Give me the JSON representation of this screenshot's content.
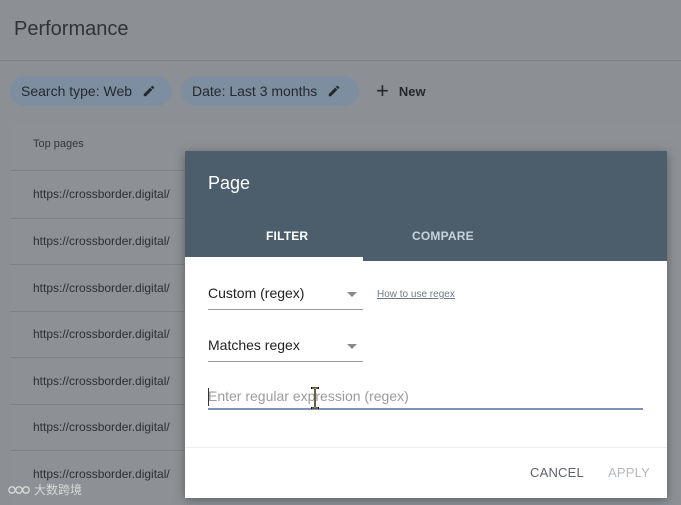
{
  "page": {
    "title": "Performance"
  },
  "chips": [
    {
      "label": "Search type: Web",
      "icon": "pencil-icon"
    },
    {
      "label": "Date: Last 3 months",
      "icon": "pencil-icon"
    }
  ],
  "new_button": {
    "icon": "+",
    "label": "New"
  },
  "table": {
    "header": "Top pages",
    "rows": [
      "https://crossborder.digital/",
      "https://crossborder.digital/",
      "https://crossborder.digital/",
      "https://crossborder.digital/",
      "https://crossborder.digital/",
      "https://crossborder.digital/",
      "https://crossborder.digital/"
    ]
  },
  "modal": {
    "title": "Page",
    "tabs": [
      "FILTER",
      "COMPARE"
    ],
    "active_tab": "FILTER",
    "filter_type": "Custom (regex)",
    "help_link": "How to use regex",
    "match_type": "Matches regex",
    "regex_placeholder": "Enter regular expression (regex)",
    "buttons": {
      "cancel": "CANCEL",
      "apply": "APPLY"
    }
  },
  "watermark": "大数跨境",
  "colors": {
    "header": "#4c5e6c",
    "overlay": "#8c9094",
    "chip": "#7d8ea0",
    "focus_underline": "#7f93b6"
  }
}
